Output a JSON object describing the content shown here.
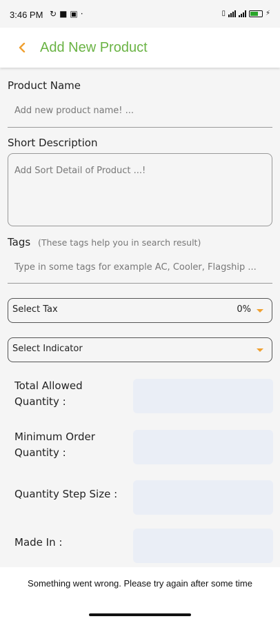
{
  "status_bar": {
    "time": "3:46 PM",
    "left_icons": [
      "sync-icon",
      "notification-icon",
      "linkedin-icon",
      "dot-icon"
    ],
    "right_icons": [
      "vibrate-icon",
      "wifi-icon",
      "signal-icon",
      "battery-icon",
      "charging-icon"
    ],
    "battery_level": 0.7
  },
  "app_bar": {
    "back_icon": "chevron-left-icon",
    "title": "Add New Product",
    "title_color": "#6ab344",
    "accent_color": "#f0a030"
  },
  "form": {
    "product_name": {
      "label": "Product Name",
      "placeholder": "Add new product name! ..."
    },
    "short_description": {
      "label": "Short Description",
      "placeholder": "Add Sort Detail of Product ...!"
    },
    "tags": {
      "label": "Tags",
      "hint": "(These tags help you in search result)",
      "placeholder": "Type in some tags for example AC, Cooler, Flagship ..."
    },
    "tax_select": {
      "label": "Select Tax",
      "value": "0%"
    },
    "indicator_select": {
      "label": "Select Indicator"
    },
    "total_allowed_quantity": {
      "label_line1": "Total Allowed",
      "label_line2": "Quantity :"
    },
    "minimum_order_quantity": {
      "label_line1": "Minimum Order",
      "label_line2": "Quantity :"
    },
    "quantity_step_size": {
      "label": "Quantity Step Size :"
    },
    "made_in": {
      "label": "Made In :"
    }
  },
  "snackbar": {
    "message": "Something went wrong. Please try again after some time"
  }
}
